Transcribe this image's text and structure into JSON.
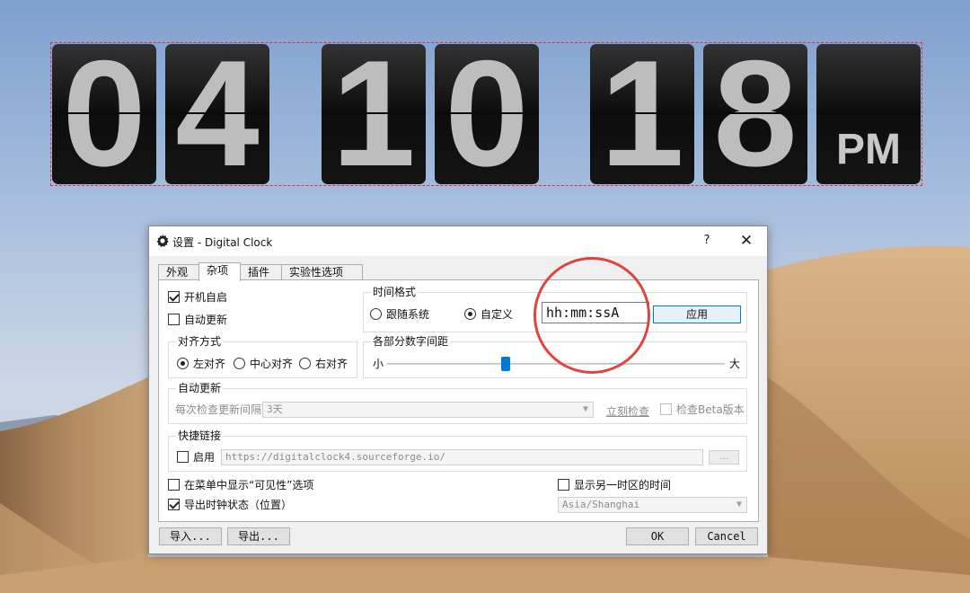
{
  "clock": {
    "digits": [
      "0",
      "4",
      "1",
      "0",
      "1",
      "8"
    ],
    "ampm": "PM"
  },
  "dialog": {
    "title": "设置 - Digital Clock",
    "help_label": "?",
    "close_label": "✕",
    "tabs": [
      "外观",
      "杂项",
      "插件",
      "实验性选项"
    ],
    "active_tab": "杂项",
    "autostart": {
      "label": "开机自启",
      "checked": true
    },
    "auto_update_check": {
      "label": "自动更新",
      "checked": false
    },
    "time_format": {
      "title": "时间格式",
      "follow_system_label": "跟随系统",
      "custom_label": "自定义",
      "selected": "自定义",
      "value": "hh:mm:ssA",
      "apply_label": "应用"
    },
    "alignment": {
      "title": "对齐方式",
      "options": [
        "左对齐",
        "中心对齐",
        "右对齐"
      ],
      "selected": "左对齐"
    },
    "spacing": {
      "title": "各部分数字间距",
      "min_label": "小",
      "max_label": "大",
      "value_fraction": 0.35
    },
    "update": {
      "title": "自动更新",
      "interval_label": "每次检查更新间隔",
      "interval_value": "3天",
      "check_now_label": "立刻检查",
      "beta_label": "检查Beta版本"
    },
    "shortcut": {
      "title": "快捷链接",
      "enable_label": "启用",
      "url": "https://digitalclock4.sourceforge.io/",
      "browse_label": "..."
    },
    "show_visibility_menu": {
      "label": "在菜单中显示“可见性”选项",
      "checked": false
    },
    "export_state": {
      "label": "导出时钟状态（位置）",
      "checked": true
    },
    "other_timezone": {
      "label": "显示另一时区的时间",
      "checked": false,
      "value": "Asia/Shanghai"
    },
    "import_label": "导入...",
    "export_label": "导出...",
    "ok_label": "OK",
    "cancel_label": "Cancel"
  },
  "colors": {
    "accent": "#0078d7",
    "highlight_circle": "#e0443e",
    "clock_card": "#111111",
    "clock_digit": "#bdbdbd"
  }
}
